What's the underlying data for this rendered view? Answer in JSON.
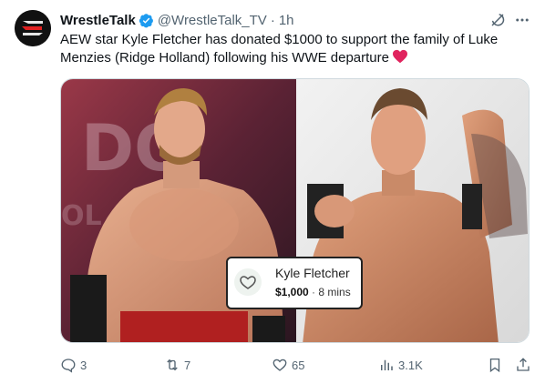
{
  "tweet": {
    "author": {
      "display_name": "WrestleTalk",
      "handle": "@WrestleTalk_TV",
      "verified": true
    },
    "separator": "·",
    "time": "1h",
    "text": "AEW star Kyle Fletcher has donated $1000 to support the family of Luke Menzies (Ridge Holland) following his WWE departure",
    "media": {
      "donation_card": {
        "name": "Kyle Fletcher",
        "amount": "$1,000",
        "separator": "·",
        "time": "8 mins"
      }
    },
    "actions": {
      "replies": "3",
      "reposts": "7",
      "likes": "65",
      "views": "3.1K"
    }
  },
  "colors": {
    "text": "#0f1419",
    "secondary": "#536471",
    "verified": "#1d9bf0",
    "heart": "#e0245e"
  },
  "icons": [
    "wrestletalk-logo",
    "verified-badge-icon",
    "grok-icon",
    "more-icon",
    "red-heart-emoji",
    "reply-icon",
    "repost-icon",
    "like-icon",
    "views-icon",
    "bookmark-icon",
    "share-icon",
    "gofundme-heart-icon"
  ]
}
